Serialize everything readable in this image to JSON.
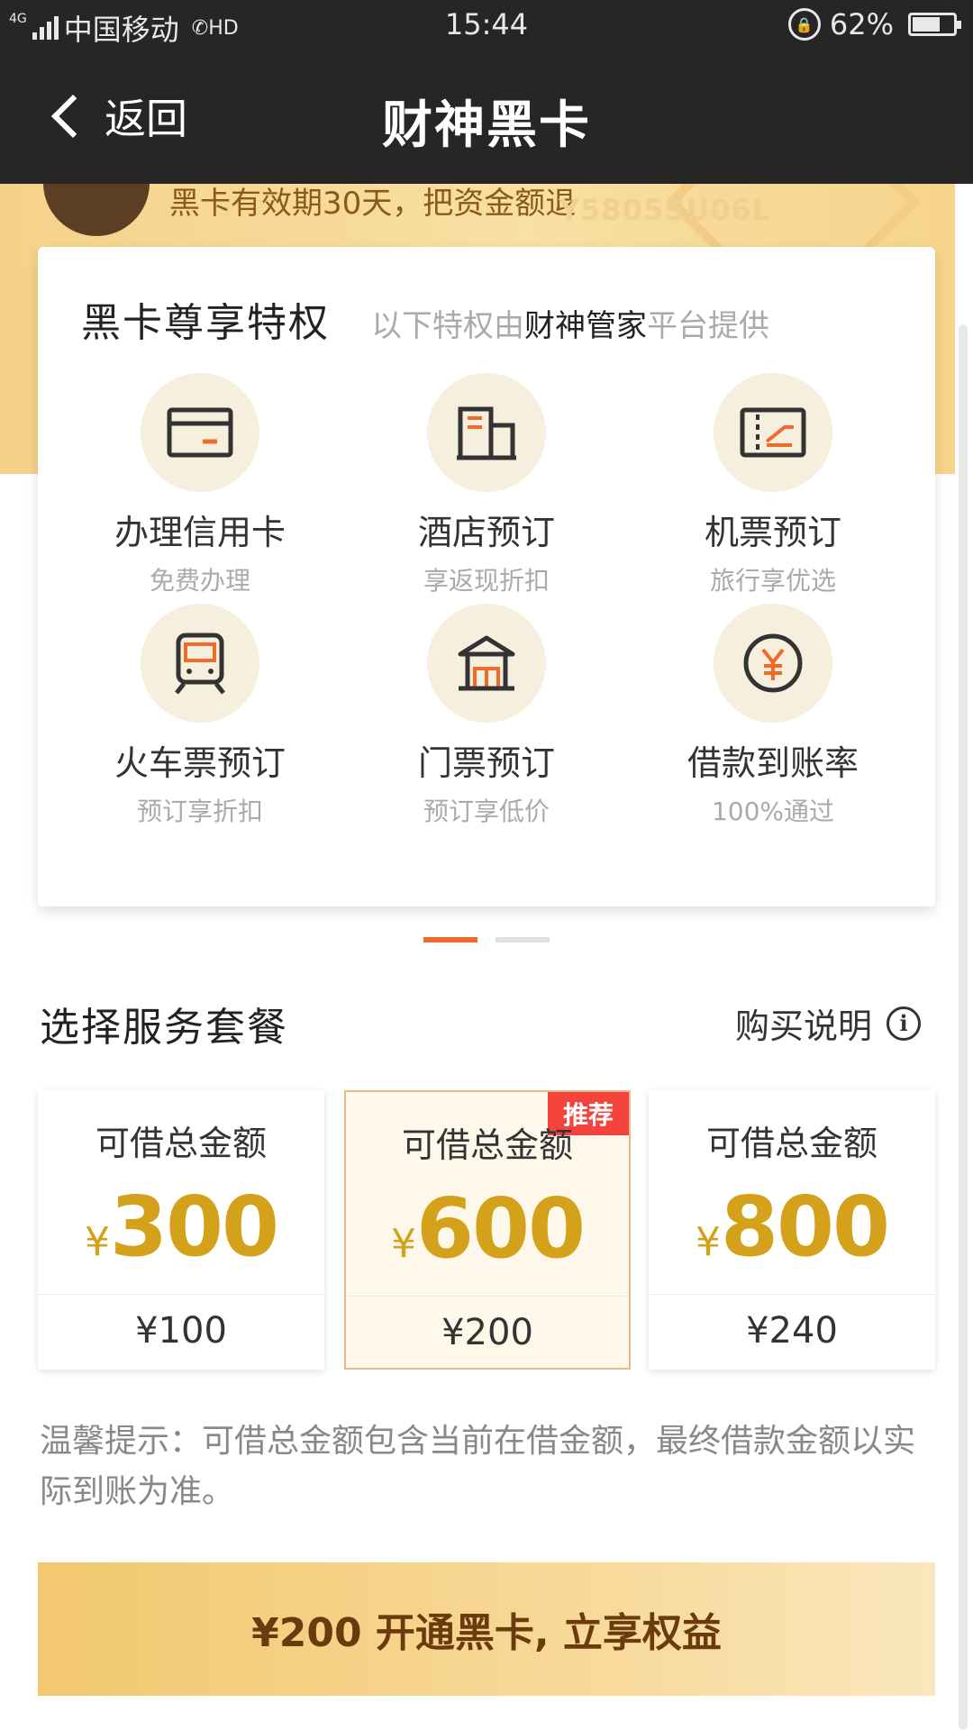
{
  "status_bar": {
    "network": "4G",
    "carrier": "中国移动",
    "hd": "HD",
    "time": "15:44",
    "battery": "62%",
    "battery_level": 0.62
  },
  "nav": {
    "back_label": "返回",
    "title": "财神黑卡"
  },
  "banner": {
    "validity_text": "黑卡有效期30天，把资金额退",
    "card_number": "Y5805SU06L"
  },
  "privileges": {
    "title": "黑卡尊享特权",
    "provider_prefix": "以下特权由",
    "provider_name": "财神管家",
    "provider_suffix": "平台提供",
    "items": [
      {
        "name": "办理信用卡",
        "sub": "免费办理",
        "icon": "credit-card-icon"
      },
      {
        "name": "酒店预订",
        "sub": "享返现折扣",
        "icon": "hotel-icon"
      },
      {
        "name": "机票预订",
        "sub": "旅行享优选",
        "icon": "plane-ticket-icon"
      },
      {
        "name": "火车票预订",
        "sub": "预订享折扣",
        "icon": "train-icon"
      },
      {
        "name": "门票预订",
        "sub": "预订享低价",
        "icon": "attraction-gate-icon"
      },
      {
        "name": "借款到账率",
        "sub": "100%通过",
        "icon": "yen-coin-icon"
      }
    ]
  },
  "section": {
    "title": "选择服务套餐",
    "buy_info": "购买说明"
  },
  "packages": [
    {
      "label": "可借总金额",
      "yen": "¥",
      "amount": "300",
      "price": "¥100",
      "selected": false
    },
    {
      "label": "可借总金额",
      "yen": "¥",
      "amount": "600",
      "price": "¥200",
      "selected": true,
      "badge": "推荐"
    },
    {
      "label": "可借总金额",
      "yen": "¥",
      "amount": "800",
      "price": "¥240",
      "selected": false
    }
  ],
  "tip": "温馨提示：可借总金额包含当前在借金额，最终借款金额以实际到账为准。",
  "cta": "¥200 开通黑卡, 立享权益",
  "colors": {
    "accent_gold": "#d4a21a",
    "orange": "#f06a2a",
    "badge_red": "#f4433c",
    "dark_bar": "#262626"
  }
}
